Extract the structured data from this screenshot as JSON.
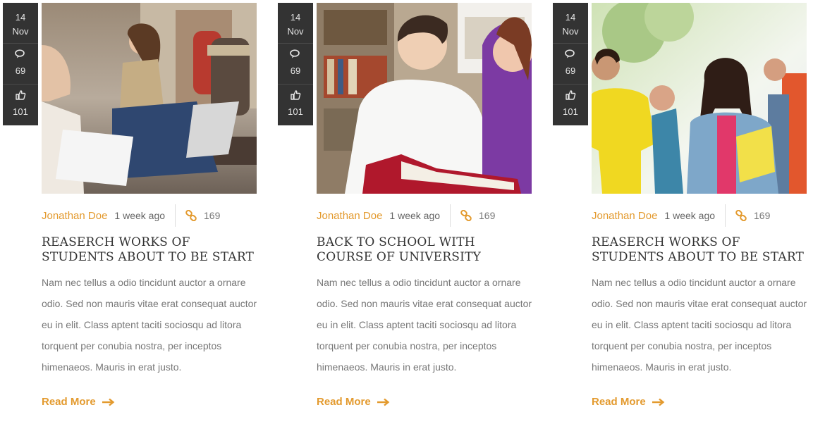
{
  "colors": {
    "accent": "#e39a2e",
    "sidebar": "#333333"
  },
  "posts": [
    {
      "day": "14",
      "month": "Nov",
      "comments": "69",
      "likes": "101",
      "author": "Jonathan Doe",
      "ago": "1 week ago",
      "links": "169",
      "title": "REASERCH WORKS OF STUDENTS ABOUT TO BE START",
      "excerpt": "Nam nec tellus a odio tincidunt auctor a ornare odio. Sed non mauris vitae erat consequat auctor eu in elit. Class aptent taciti sociosqu ad litora torquent per conubia nostra, per inceptos himenaeos. Mauris in erat justo.",
      "read_more": "Read More",
      "image_icon": "student-laptop-photo"
    },
    {
      "day": "14",
      "month": "Nov",
      "comments": "69",
      "likes": "101",
      "author": "Jonathan Doe",
      "ago": "1 week ago",
      "links": "169",
      "title": "BACK TO SCHOOL WITH COURSE OF UNIVERSITY",
      "excerpt": "Nam nec tellus a odio tincidunt auctor a ornare odio. Sed non mauris vitae erat consequat auctor eu in elit. Class aptent taciti sociosqu ad litora torquent per conubia nostra, per inceptos himenaeos. Mauris in erat justo.",
      "read_more": "Read More",
      "image_icon": "library-book-photo"
    },
    {
      "day": "14",
      "month": "Nov",
      "comments": "69",
      "likes": "101",
      "author": "Jonathan Doe",
      "ago": "1 week ago",
      "links": "169",
      "title": "REASERCH WORKS OF STUDENTS ABOUT TO BE START",
      "excerpt": "Nam nec tellus a odio tincidunt auctor a ornare odio. Sed non mauris vitae erat consequat auctor eu in elit. Class aptent taciti sociosqu ad litora torquent per conubia nostra, per inceptos himenaeos. Mauris in erat justo.",
      "read_more": "Read More",
      "image_icon": "student-group-photo"
    }
  ]
}
